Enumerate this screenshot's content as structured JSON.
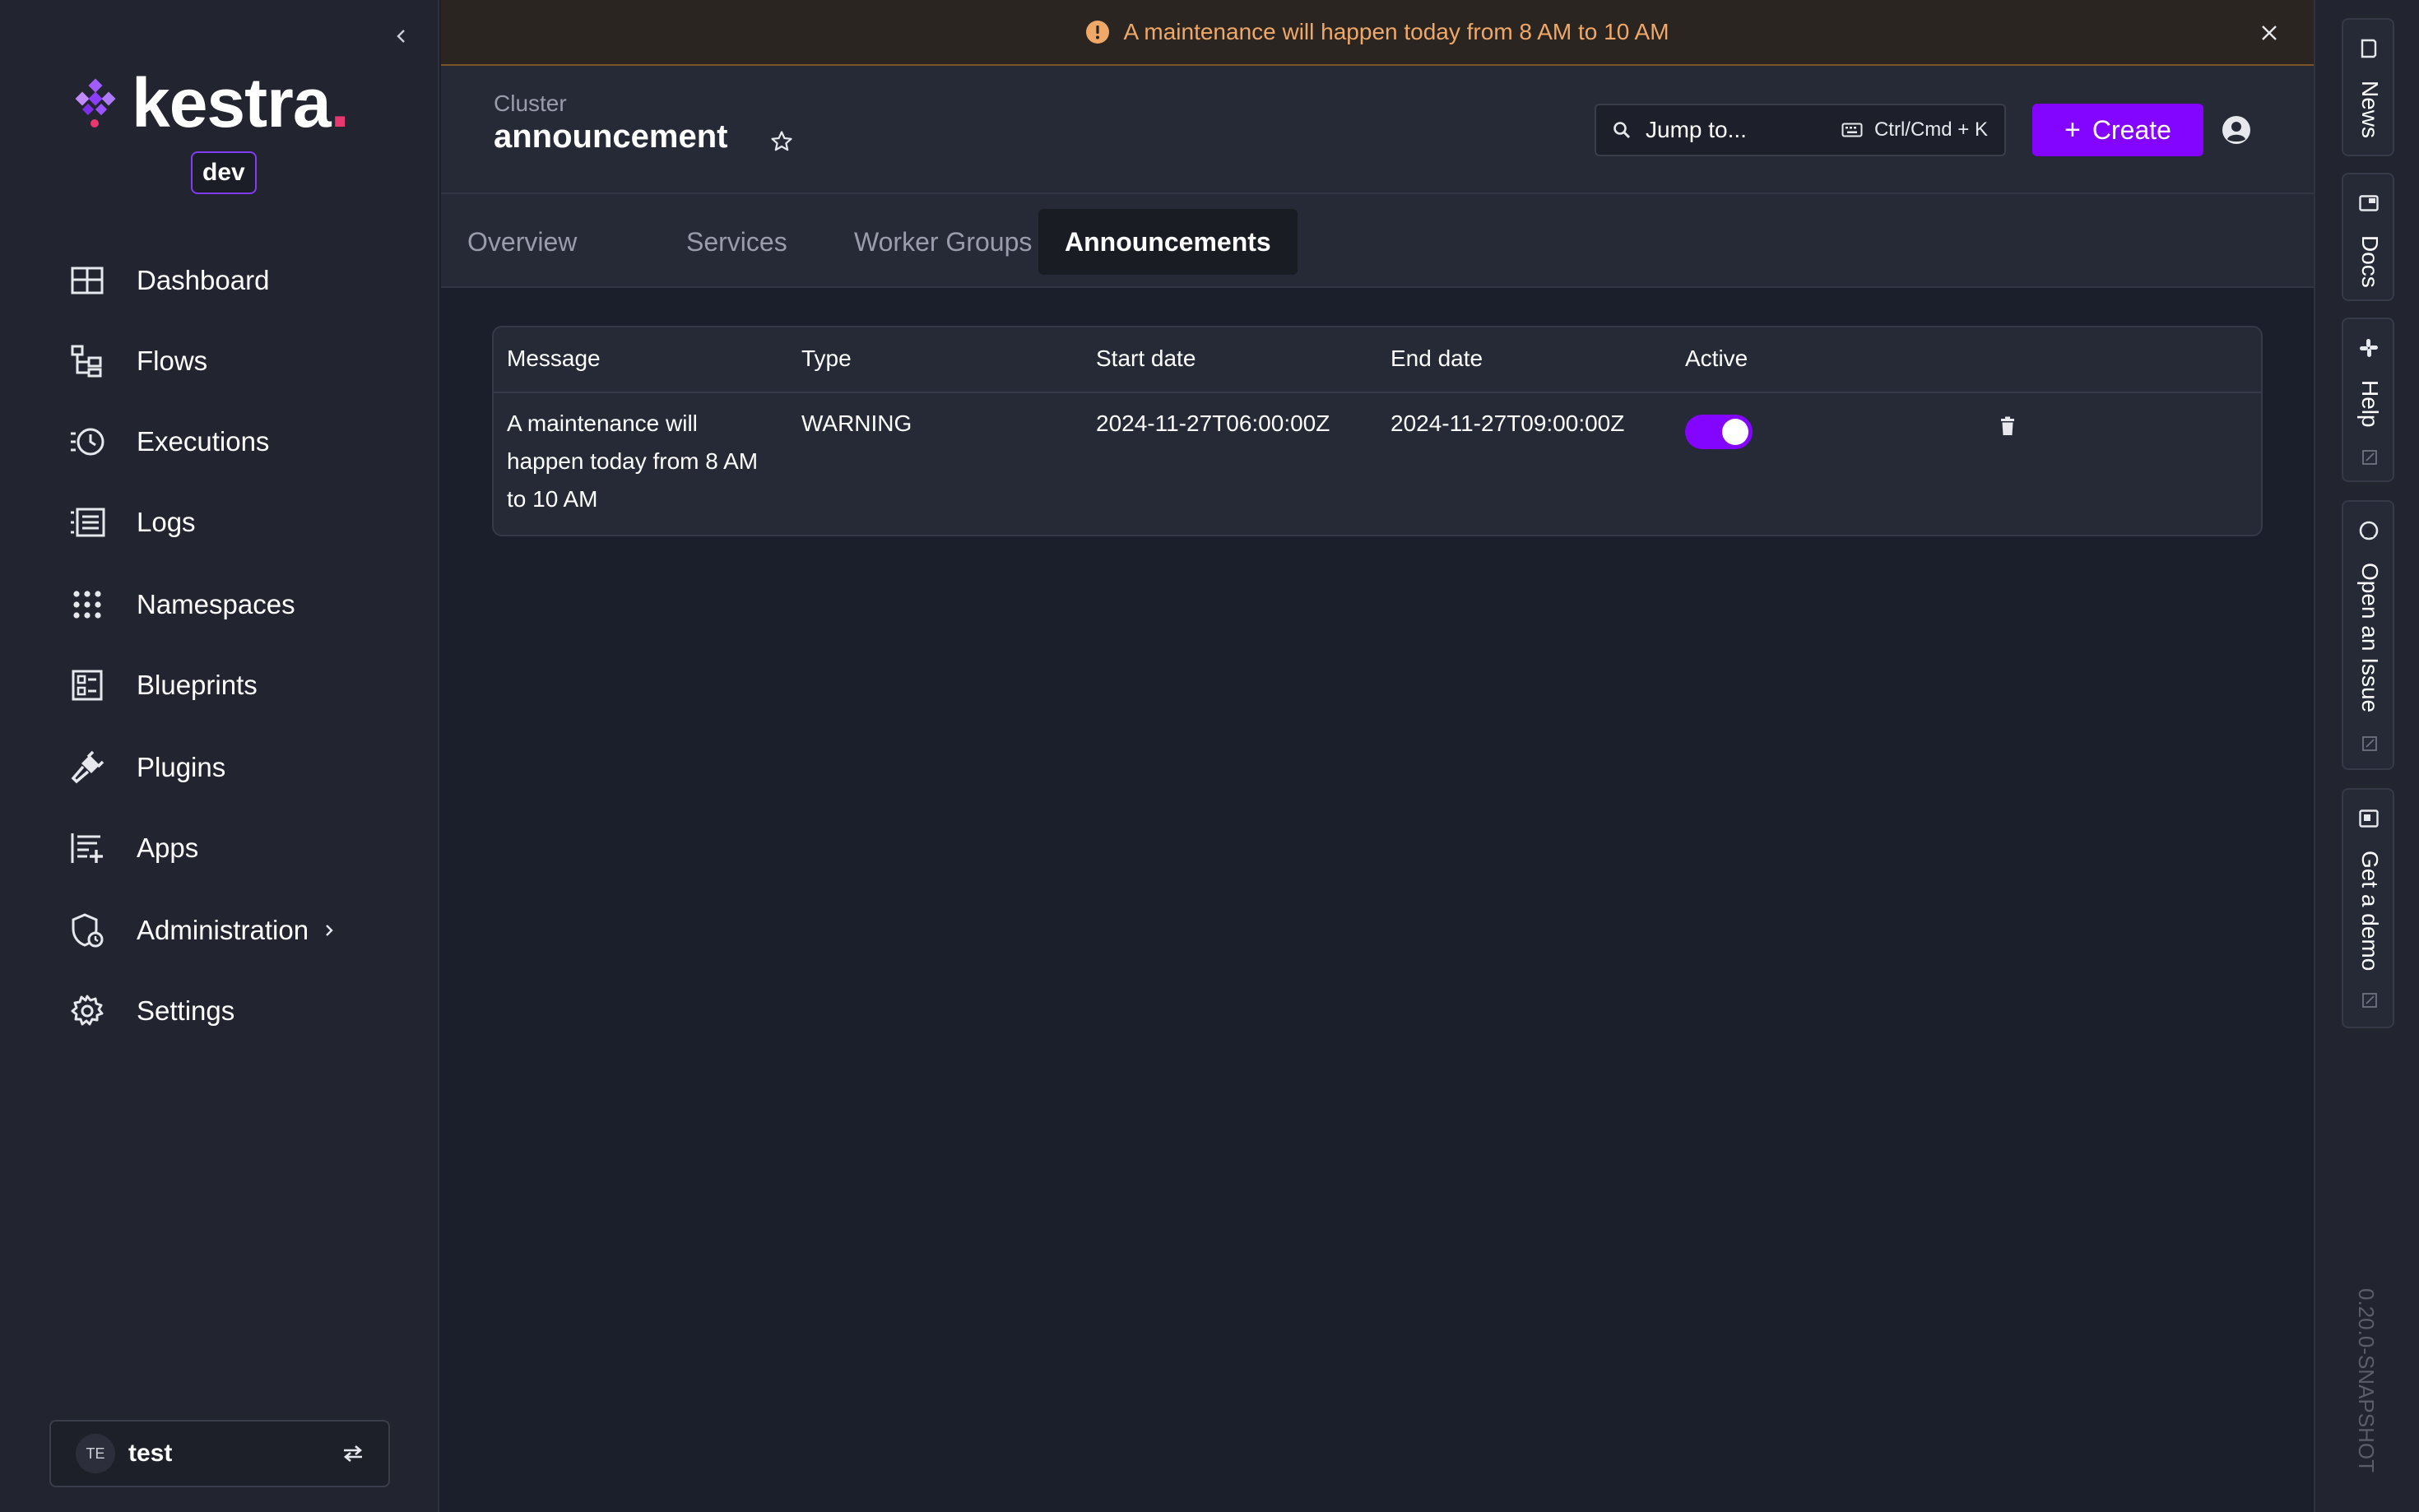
{
  "banner": {
    "message": "A maintenance will happen today from 8 AM to 10 AM"
  },
  "brand": {
    "name": "kestra",
    "dot": ".",
    "environment": "dev"
  },
  "sidebar": {
    "items": [
      {
        "label": "Dashboard",
        "icon": "dashboard-icon"
      },
      {
        "label": "Flows",
        "icon": "flows-icon"
      },
      {
        "label": "Executions",
        "icon": "executions-icon"
      },
      {
        "label": "Logs",
        "icon": "logs-icon"
      },
      {
        "label": "Namespaces",
        "icon": "namespaces-icon"
      },
      {
        "label": "Blueprints",
        "icon": "blueprints-icon"
      },
      {
        "label": "Plugins",
        "icon": "plugins-icon"
      },
      {
        "label": "Apps",
        "icon": "apps-icon"
      },
      {
        "label": "Administration",
        "icon": "administration-icon"
      },
      {
        "label": "Settings",
        "icon": "settings-icon"
      }
    ],
    "tenant": {
      "initials": "TE",
      "name": "test"
    }
  },
  "header": {
    "breadcrumb": "Cluster",
    "title": "announcement",
    "search_label": "Jump to...",
    "shortcut": "Ctrl/Cmd + K",
    "create_label": "Create"
  },
  "tabs": [
    {
      "label": "Overview",
      "active": false
    },
    {
      "label": "Services",
      "active": false
    },
    {
      "label": "Worker Groups",
      "active": false
    },
    {
      "label": "Announcements",
      "active": true
    }
  ],
  "table": {
    "columns": [
      "Message",
      "Type",
      "Start date",
      "End date",
      "Active"
    ],
    "rows": [
      {
        "message_lines": [
          "A maintenance will",
          "happen today from 8 AM",
          "to 10 AM"
        ],
        "type": "WARNING",
        "start": "2024-11-27T06:00:00Z",
        "end": "2024-11-27T09:00:00Z",
        "active": true
      }
    ]
  },
  "right_rail": {
    "buttons": [
      {
        "label": "News",
        "icon": "news-icon"
      },
      {
        "label": "Docs",
        "icon": "docs-icon"
      },
      {
        "label": "Help",
        "icon": "slack-icon"
      },
      {
        "label": "Open an Issue",
        "icon": "github-icon"
      },
      {
        "label": "Get a demo",
        "icon": "demo-icon"
      }
    ],
    "version": "0.20.0-SNAPSHOT"
  },
  "colors": {
    "accent": "#8405ff",
    "warning": "#f0a868",
    "background": "#1b1e2b",
    "surface": "#262a37"
  }
}
